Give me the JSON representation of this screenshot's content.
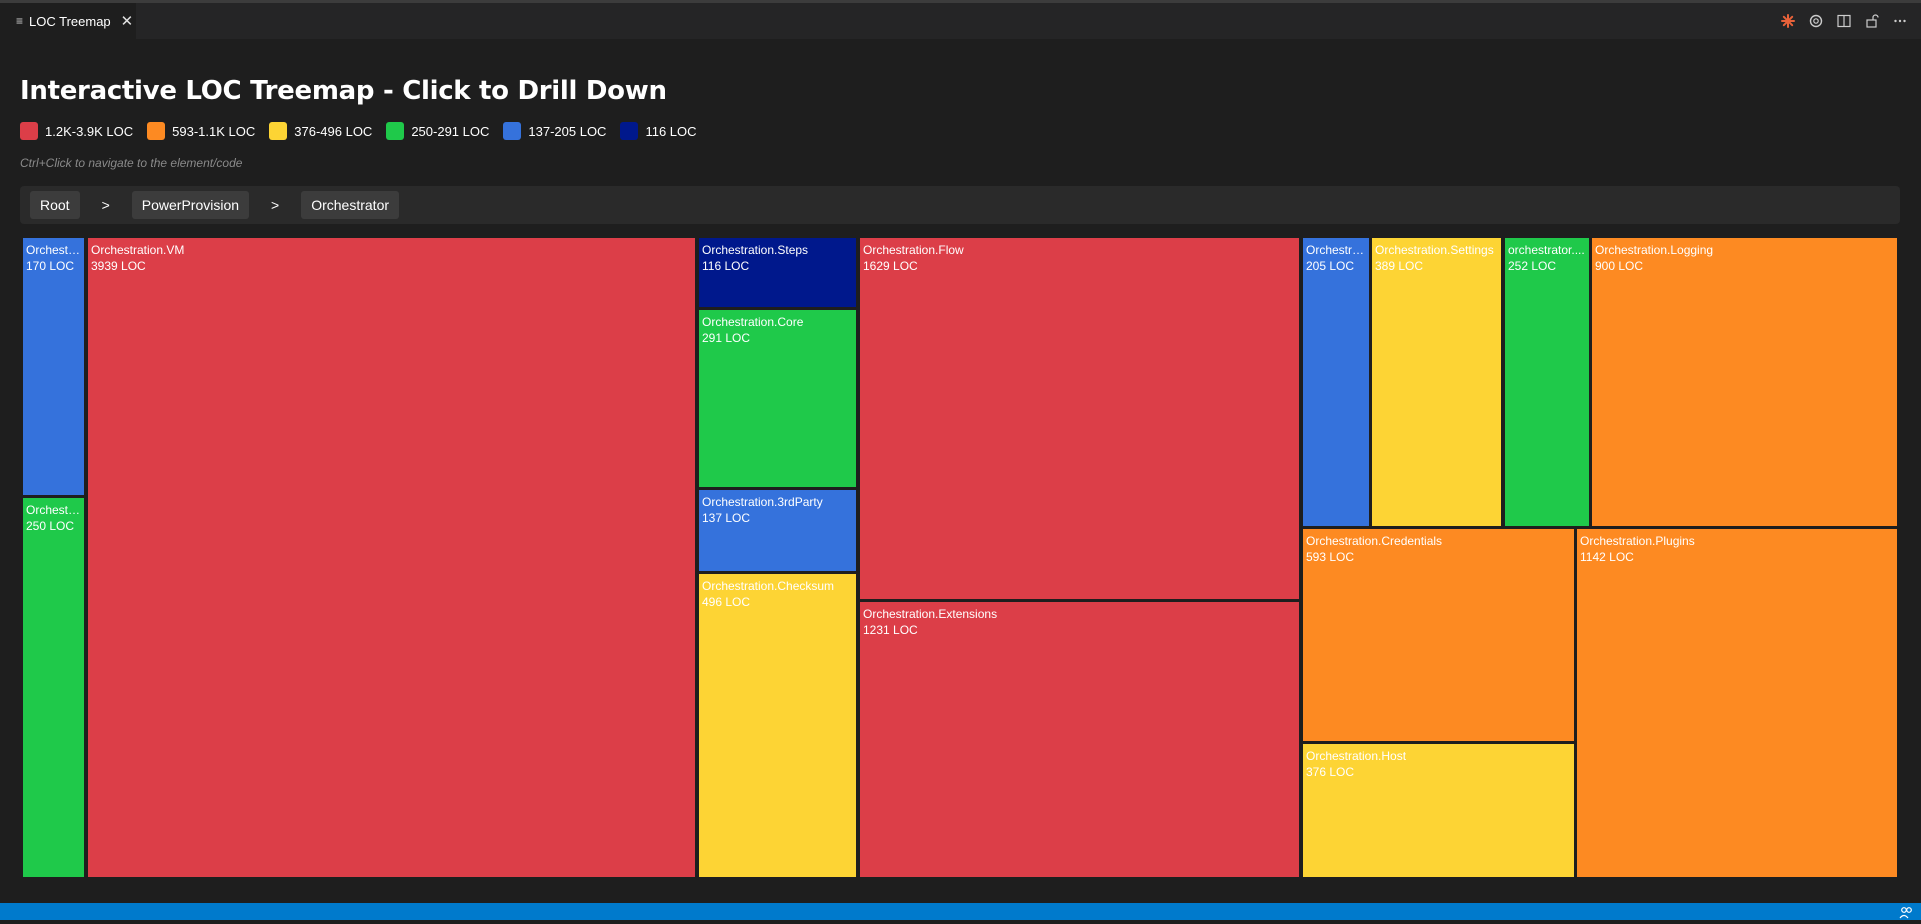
{
  "tab": {
    "label": "LOC Treemap",
    "icon": "preview-icon",
    "close_icon": "close-icon"
  },
  "actions": [
    "sparkle-icon",
    "openai-icon",
    "split-editor-icon",
    "lock-icon",
    "more-icon"
  ],
  "header": {
    "title": "Interactive LOC Treemap - Click to Drill Down"
  },
  "legend": [
    {
      "label": "1.2K-3.9K LOC",
      "color": "#dc3e48"
    },
    {
      "label": "593-1.1K LOC",
      "color": "#fd8a22"
    },
    {
      "label": "376-496 LOC",
      "color": "#fdd434"
    },
    {
      "label": "250-291 LOC",
      "color": "#1fc94a"
    },
    {
      "label": "137-205 LOC",
      "color": "#3572dc"
    },
    {
      "label": "116 LOC",
      "color": "#00188c"
    }
  ],
  "hint": "Ctrl+Click to navigate to the element/code",
  "breadcrumb": {
    "items": [
      "Root",
      "PowerProvision",
      "Orchestrator"
    ],
    "separator": ">"
  },
  "treemap": {
    "nodes": [
      {
        "name": "Orchestra...",
        "loc_label": "170 LOC",
        "loc": 170,
        "color": "#3572dc"
      },
      {
        "name": "Orchestra...",
        "loc_label": "250 LOC",
        "loc": 250,
        "color": "#1fc94a"
      },
      {
        "name": "Orchestration.VM",
        "loc_label": "3939 LOC",
        "loc": 3939,
        "color": "#dc3e48"
      },
      {
        "name": "Orchestration.Steps",
        "loc_label": "116 LOC",
        "loc": 116,
        "color": "#00188c"
      },
      {
        "name": "Orchestration.Core",
        "loc_label": "291 LOC",
        "loc": 291,
        "color": "#1fc94a"
      },
      {
        "name": "Orchestration.3rdParty",
        "loc_label": "137 LOC",
        "loc": 137,
        "color": "#3572dc"
      },
      {
        "name": "Orchestration.Checksum",
        "loc_label": "496 LOC",
        "loc": 496,
        "color": "#fdd434"
      },
      {
        "name": "Orchestration.Flow",
        "loc_label": "1629 LOC",
        "loc": 1629,
        "color": "#dc3e48"
      },
      {
        "name": "Orchestration.Extensions",
        "loc_label": "1231 LOC",
        "loc": 1231,
        "color": "#dc3e48"
      },
      {
        "name": "Orchestra...",
        "loc_label": "205 LOC",
        "loc": 205,
        "color": "#3572dc"
      },
      {
        "name": "Orchestration.Settings",
        "loc_label": "389 LOC",
        "loc": 389,
        "color": "#fdd434"
      },
      {
        "name": "orchestrator....",
        "loc_label": "252 LOC",
        "loc": 252,
        "color": "#1fc94a"
      },
      {
        "name": "Orchestration.Logging",
        "loc_label": "900 LOC",
        "loc": 900,
        "color": "#fd8a22"
      },
      {
        "name": "Orchestration.Credentials",
        "loc_label": "593 LOC",
        "loc": 593,
        "color": "#fd8a22"
      },
      {
        "name": "Orchestration.Host",
        "loc_label": "376 LOC",
        "loc": 376,
        "color": "#fdd434"
      },
      {
        "name": "Orchestration.Plugins",
        "loc_label": "1142 LOC",
        "loc": 1142,
        "color": "#fd8a22"
      }
    ]
  }
}
